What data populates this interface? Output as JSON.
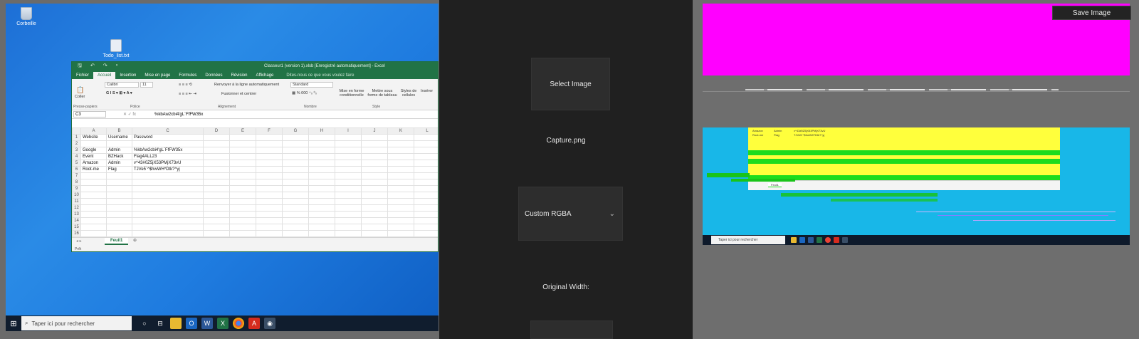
{
  "desktop": {
    "icons": [
      {
        "label": "Corbeille",
        "icon": "recycle-bin-icon"
      },
      {
        "label": "Todo_list.txt",
        "icon": "text-file-icon"
      }
    ],
    "taskbar": {
      "search_placeholder": "Taper ici pour rechercher",
      "apps": [
        "task-view-icon",
        "file-explorer-icon",
        "outlook-icon",
        "word-icon",
        "excel-icon",
        "chrome-icon",
        "acrobat-icon",
        "app-icon"
      ]
    }
  },
  "excel": {
    "title": "Classeur1 (version 1).xlsb [Enregistré automatiquement] - Excel",
    "tabs": [
      "Fichier",
      "Accueil",
      "Insertion",
      "Mise en page",
      "Formules",
      "Données",
      "Révision",
      "Affichage"
    ],
    "active_tab": "Accueil",
    "tell_me": "Dites-nous ce que vous voulez faire",
    "ribbon": {
      "paste_label": "Coller",
      "font_name": "Calibri",
      "font_size": "11",
      "wrap_label": "Renvoyer à la ligne automatiquement",
      "merge_label": "Fusionner et centrer",
      "number_format": "Standard",
      "cond_format": "Mise en forme conditionnelle",
      "table_format": "Mettre sous forme de tableau",
      "cell_styles": "Styles de cellules",
      "insert": "Insérer",
      "groups": [
        "Presse-papiers",
        "Police",
        "Alignement",
        "Nombre",
        "Style"
      ]
    },
    "name_box": "C3",
    "formula": "%kbAw2cbi4'gL`FfFW35x",
    "column_headers": [
      "",
      "A",
      "B",
      "C",
      "D",
      "E",
      "F",
      "G",
      "H",
      "I",
      "J",
      "K",
      "L"
    ],
    "rows": [
      [
        "1",
        "Website",
        "Username",
        "Password"
      ],
      [
        "2",
        "",
        "",
        ""
      ],
      [
        "3",
        "Google",
        "Admin",
        "%kbAw2cbi4'gL`FfFW35x"
      ],
      [
        "4",
        "Event",
        "BZHack",
        "Flag4ALL23"
      ],
      [
        "5",
        "Amazon",
        "Admin",
        "v^43#0Z5jX53PMjX73vU"
      ],
      [
        "6",
        "Root-me",
        "Flag",
        "TJVe5`^$hwWH*Dtk?^yj"
      ],
      [
        "7",
        "",
        "",
        ""
      ],
      [
        "8",
        "",
        "",
        ""
      ],
      [
        "9",
        "",
        "",
        ""
      ],
      [
        "10",
        "",
        "",
        ""
      ],
      [
        "11",
        "",
        "",
        ""
      ],
      [
        "12",
        "",
        "",
        ""
      ],
      [
        "13",
        "",
        "",
        ""
      ],
      [
        "14",
        "",
        "",
        ""
      ],
      [
        "15",
        "",
        "",
        ""
      ],
      [
        "16",
        "",
        "",
        ""
      ]
    ],
    "sheet_tab": "Feuil1",
    "status": "Prêt"
  },
  "controls": {
    "select_image_label": "Select Image",
    "file_name": "Capture.png",
    "mode_selected": "Custom RGBA",
    "original_width_label": "Original Width:"
  },
  "output": {
    "save_image_label": "Save Image",
    "colors": {
      "magenta": "#ff00ff",
      "cyan": "#18b7e8",
      "yellow": "#ffff3c",
      "green": "#1ddc1d"
    },
    "glitch_text": {
      "row_amazon": "Amazon",
      "row_rootme": "Root-me",
      "admin": "Admin",
      "flag": "Flag",
      "pw_amazon": "v^43#0Z5jX53PMjX73vU",
      "pw_rootme": "TJVe5`^$hwWH*Dtk?^yj",
      "taskbar_search": "Taper ici pour rechercher",
      "sheet_tab": "Feuil1"
    }
  }
}
